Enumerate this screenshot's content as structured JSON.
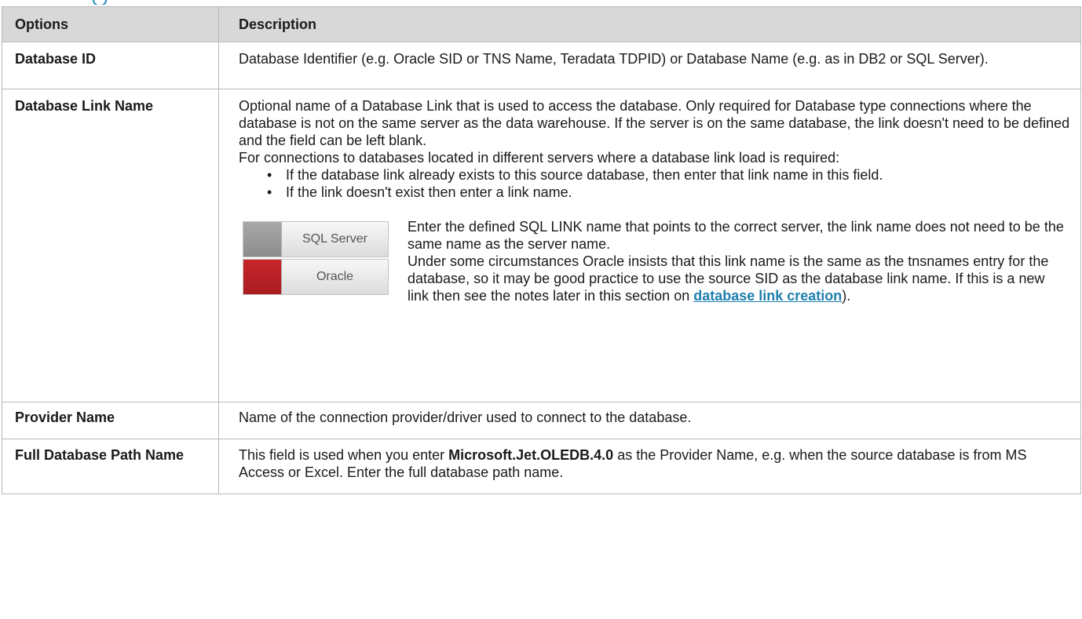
{
  "table": {
    "headers": [
      "Options",
      "Description"
    ],
    "rows": {
      "db_id": {
        "option": "Database ID",
        "desc": "Database Identifier (e.g. Oracle SID or TNS Name, Teradata TDPID) or Database Name (e.g. as in DB2 or SQL Server)."
      },
      "db_link": {
        "option": "Database Link Name",
        "p1": "Optional name of a Database Link that is used to access the database. Only required for Database type connections where the database is not on the same server as the data warehouse. If the server is on the same database, the link doesn't need to be defined and the field can be left blank.",
        "p2": "For connections to databases located in different servers where a database link load is required:",
        "bullets": [
          "If the database link already exists to this source database, then enter that link name in this field.",
          "If the link doesn't exist then enter a link name."
        ],
        "badges": [
          "SQL Server",
          "Oracle"
        ],
        "note1": "Enter the defined SQL LINK name that points to the correct server, the link name does not need to be the same name as the server name.",
        "note2": "Under some circumstances Oracle insists that this link name is the same as the tnsnames entry for the database, so it may be good practice to use the source SID as the database link name. If this is a new link then see the notes later in this section on ",
        "note_link": "database link creation",
        "note_end": ")."
      },
      "provider": {
        "option": "Provider Name",
        "desc": "Name of the connection provider/driver used to connect to the database."
      },
      "full_path": {
        "option": "Full Database Path Name",
        "desc_pre": "This field is used when you enter ",
        "desc_bold": "Microsoft.Jet.OLEDB.4.0",
        "desc_post": " as the Provider Name, e.g. when the source database is from MS Access or Excel. Enter the full database path name."
      }
    }
  },
  "colors": {
    "link": "#1f7fae",
    "header_bg": "#d8d8d8",
    "oracle_red": "#c8262c",
    "sql_gray": "#9a9a9a"
  }
}
